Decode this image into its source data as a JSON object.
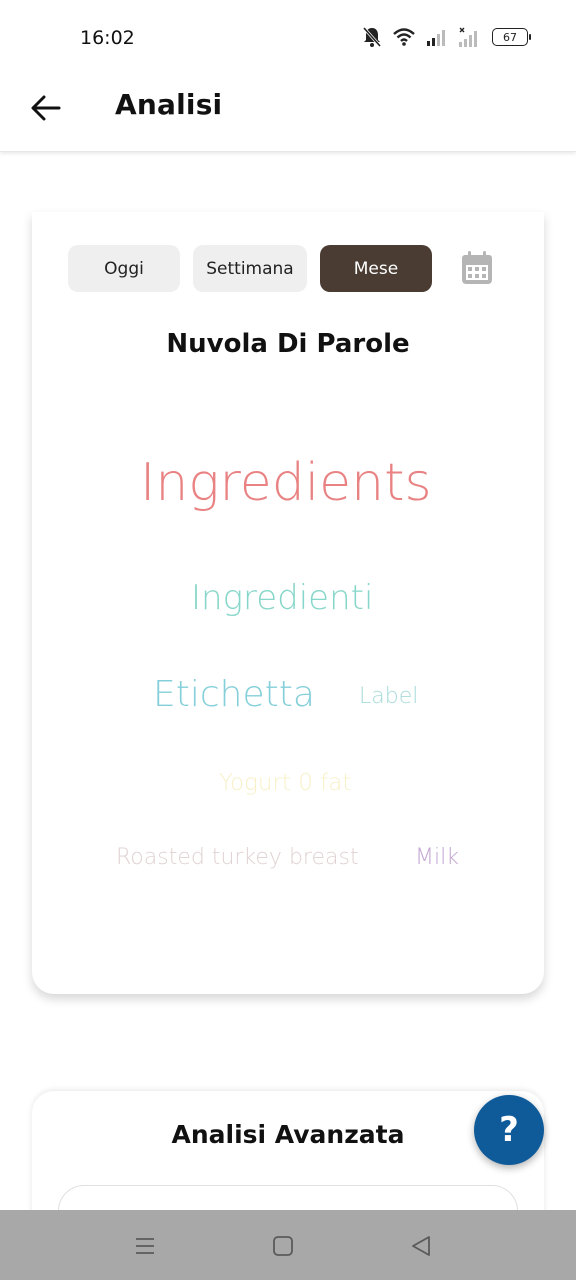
{
  "status_bar": {
    "time": "16:02",
    "battery": "67"
  },
  "app_bar": {
    "title": "Analisi"
  },
  "period_selector": {
    "options": [
      "Oggi",
      "Settimana",
      "Mese"
    ],
    "selected": "Mese"
  },
  "word_cloud": {
    "title": "Nuvola Di Parole",
    "words": [
      {
        "text": "Ingredients",
        "color": "#e98282"
      },
      {
        "text": "Ingredienti",
        "color": "#86d6c9"
      },
      {
        "text": "Etichetta",
        "color": "#84cfd9"
      },
      {
        "text": "Label",
        "color": "#a7dbd8"
      },
      {
        "text": "Yogurt 0 fat",
        "color": "#f7f0c8"
      },
      {
        "text": "Roasted turkey breast",
        "color": "#e0d2d2"
      },
      {
        "text": "Milk",
        "color": "#c2a5d2"
      }
    ]
  },
  "advanced": {
    "title": "Analisi Avanzata"
  },
  "fab": {
    "label": "?"
  },
  "icons": {
    "back": "arrow-left-icon",
    "calendar": "calendar-icon",
    "help": "help-icon"
  },
  "colors": {
    "active_segment": "#4a3c33",
    "inactive_segment": "#efefef",
    "fab": "#0f5b9a",
    "nav_bar": "#a8a8a8"
  }
}
